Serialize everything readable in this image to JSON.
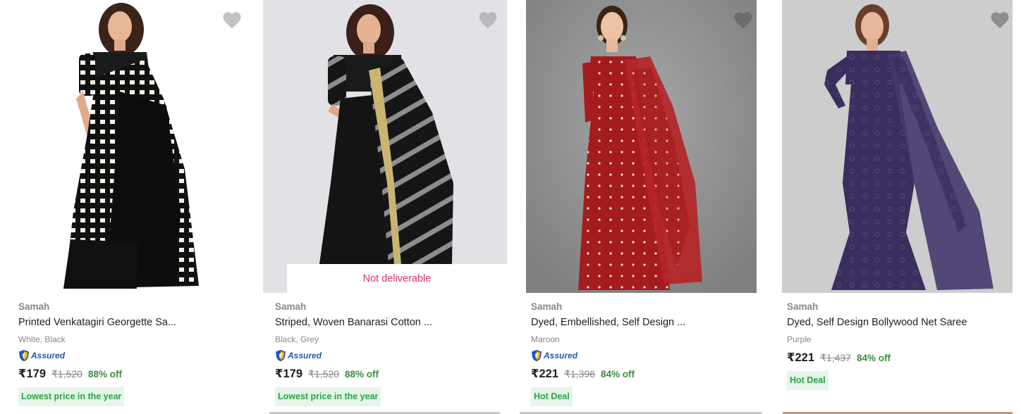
{
  "products": [
    {
      "brand": "Samah",
      "title": "Printed Venkatagiri Georgette Sa...",
      "color": "White, Black",
      "assured": "Assured",
      "price": "₹179",
      "mrp": "₹1,520",
      "discount": "88% off",
      "tag": "Lowest price in the year",
      "saree_color": "#111111",
      "pattern": "checks",
      "bg_color": "#ffffff",
      "wishlist_icon": "heart-icon"
    },
    {
      "brand": "Samah",
      "title": "Striped, Woven Banarasi Cotton ...",
      "color": "Black, Grey",
      "assured": "Assured",
      "price": "₹179",
      "mrp": "₹1,520",
      "discount": "88% off",
      "tag": "Lowest price in the year",
      "overlay": "Not deliverable",
      "saree_color": "#151515",
      "pattern": "stripes",
      "bg_color": "#e2e2e6",
      "wishlist_icon": "heart-icon"
    },
    {
      "brand": "Samah",
      "title": "Dyed, Embellished, Self Design ...",
      "color": "Maroon",
      "assured": "Assured",
      "price": "₹221",
      "mrp": "₹1,396",
      "discount": "84% off",
      "tag": "Hot Deal",
      "saree_color": "#a41c1e",
      "pattern": "dots",
      "bg_color": "#8f8f8f",
      "wishlist_icon": "heart-icon"
    },
    {
      "brand": "Samah",
      "title": "Dyed, Self Design Bollywood Net Saree",
      "color": "Purple",
      "price": "₹221",
      "mrp": "₹1,437",
      "discount": "84% off",
      "tag": "Hot Deal",
      "saree_color": "#3a2e5e",
      "pattern": "lace",
      "bg_color": "#cdcdcd",
      "wishlist_icon": "heart-icon"
    }
  ],
  "colors": {
    "discount": "#388e3c",
    "tag_bg": "#e6f5ea",
    "tag_text": "#26a541",
    "assured": "#2455b5",
    "not_deliverable": "#d6336c"
  }
}
